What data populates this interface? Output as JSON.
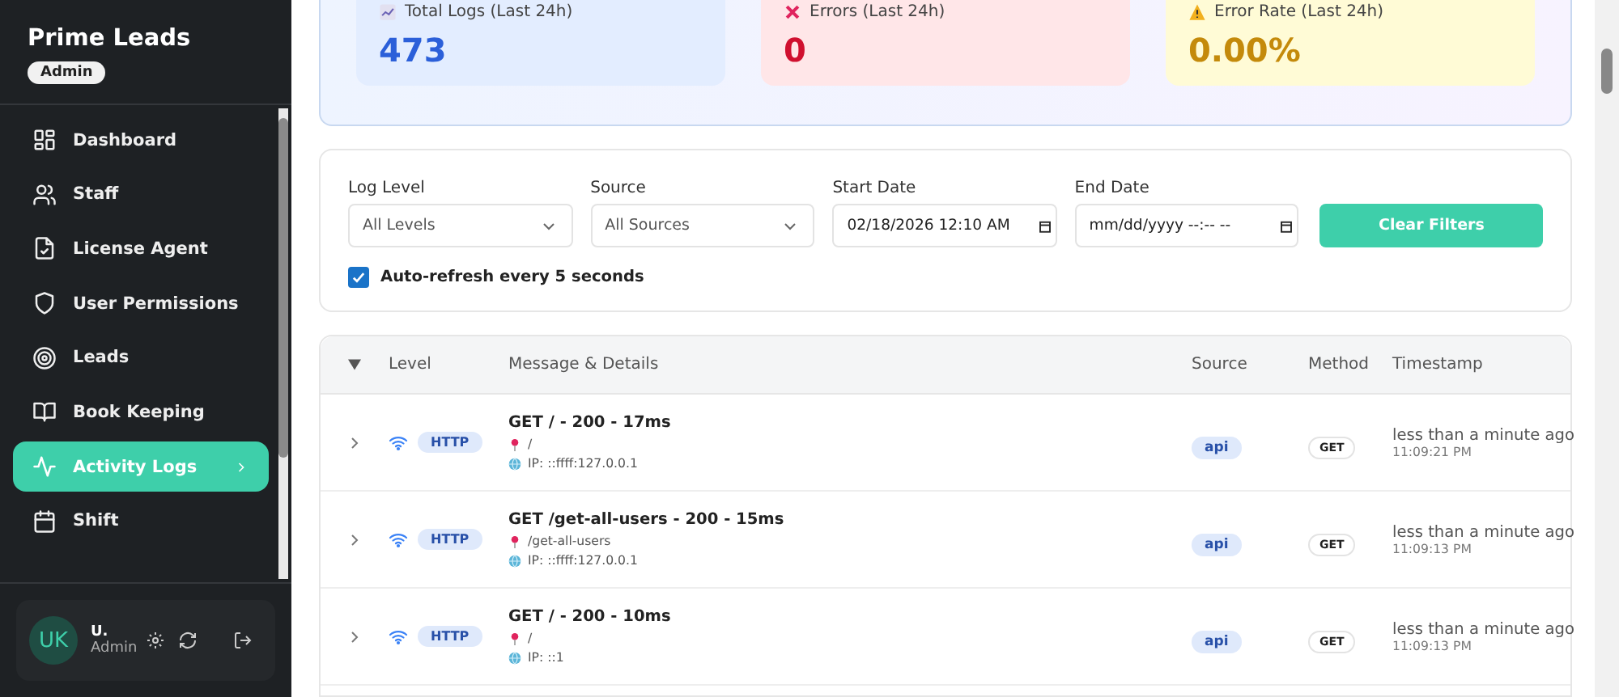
{
  "sidebar": {
    "brand": "Prime Leads",
    "role_badge": "Admin",
    "items": [
      {
        "label": "Dashboard",
        "selected": false
      },
      {
        "label": "Staff",
        "selected": false
      },
      {
        "label": "License Agent",
        "selected": false
      },
      {
        "label": "User Permissions",
        "selected": false
      },
      {
        "label": "Leads",
        "selected": false
      },
      {
        "label": "Book Keeping",
        "selected": false
      },
      {
        "label": "Activity Logs",
        "selected": true
      },
      {
        "label": "Shift",
        "selected": false
      }
    ],
    "user": {
      "initials": "UK",
      "name": "U.",
      "role": "Admin"
    }
  },
  "stats": [
    {
      "label": "Total Logs (Last 24h)",
      "value": "473",
      "kind": "total"
    },
    {
      "label": "Errors (Last 24h)",
      "value": "0",
      "kind": "error"
    },
    {
      "label": "Error Rate (Last 24h)",
      "value": "0.00%",
      "kind": "warning"
    }
  ],
  "filters": {
    "fields": [
      {
        "label": "Log Level",
        "kind": "select",
        "value": "All Levels"
      },
      {
        "label": "Source",
        "kind": "select",
        "value": "All Sources"
      },
      {
        "label": "Start Date",
        "kind": "date",
        "value": "02/18/2026 12:10 AM"
      },
      {
        "label": "End Date",
        "kind": "date",
        "placeholder": "mm/dd/yyyy --:-- --"
      }
    ],
    "button": "Clear Filters",
    "auto_refresh": {
      "label": "Auto-refresh every 5 seconds",
      "checked": true
    }
  },
  "table": {
    "columns": [
      "Level",
      "Message & Details",
      "Source",
      "Method",
      "Timestamp"
    ],
    "rows": [
      {
        "level": "HTTP",
        "message": "GET / - 200 - 17ms",
        "path": "/",
        "ip": "IP: ::ffff:127.0.0.1",
        "source": "api",
        "method": "GET",
        "relative_time": "less than a minute ago",
        "time": "11:09:21 PM"
      },
      {
        "level": "HTTP",
        "message": "GET /get-all-users - 200 - 15ms",
        "path": "/get-all-users",
        "ip": "IP: ::ffff:127.0.0.1",
        "source": "api",
        "method": "GET",
        "relative_time": "less than a minute ago",
        "time": "11:09:13 PM"
      },
      {
        "level": "HTTP",
        "message": "GET / - 200 - 10ms",
        "path": "/",
        "ip": "IP: ::1",
        "source": "api",
        "method": "GET",
        "relative_time": "less than a minute ago",
        "time": "11:09:13 PM"
      }
    ]
  }
}
